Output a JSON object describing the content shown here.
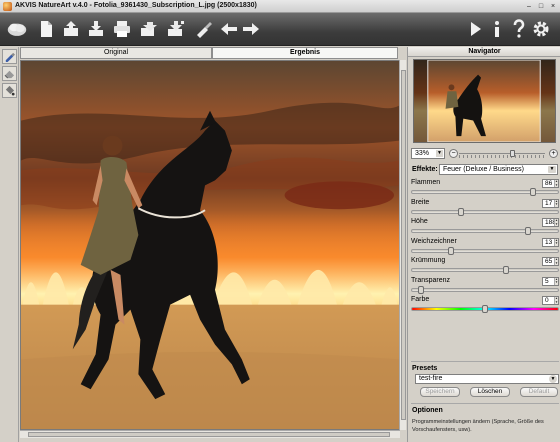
{
  "window": {
    "title": "AKVIS NatureArt v.4.0 - Fotolia_9361430_Subscription_L.jpg (2500x1830)",
    "minimize": "–",
    "maximize": "□",
    "close": "×"
  },
  "toolbar": {
    "left_icons": [
      "app-logo-icon",
      "new-document-icon",
      "open-file-icon",
      "save-file-icon",
      "print-icon",
      "export-icon",
      "import-icon",
      "brush-icon",
      "undo-arrow-icon",
      "redo-arrow-icon"
    ],
    "right_icons": [
      "run-play-icon",
      "info-icon",
      "help-icon",
      "settings-gear-icon"
    ]
  },
  "tabs": {
    "original": "Original",
    "result": "Ergebnis"
  },
  "navigator": {
    "title": "Navigator",
    "zoom": "33%",
    "zoom_level": 0.62,
    "zoom_minus": "−",
    "zoom_plus": "+"
  },
  "effects": {
    "label": "Effekte:",
    "value": "Feuer  (Deluxe / Business)"
  },
  "params": [
    {
      "label": "Flammen",
      "value": "86",
      "level": 0.84
    },
    {
      "label": "Breite",
      "value": "17",
      "level": 0.33
    },
    {
      "label": "Höhe",
      "value": "188",
      "level": 0.8
    },
    {
      "label": "Weichzeichner",
      "value": "13",
      "level": 0.26
    },
    {
      "label": "Krümmung",
      "value": "65",
      "level": 0.65
    },
    {
      "label": "Transparenz",
      "value": "5",
      "level": 0.05
    },
    {
      "label": "Farbe",
      "value": "0",
      "level": 0.5
    }
  ],
  "presets": {
    "title": "Presets",
    "value": "test-fire",
    "save": "Speichern",
    "delete": "Löschen",
    "default": "Default"
  },
  "options": {
    "title": "Optionen",
    "text": "Programmeinstellungen ändern (Sprache, Größe des Vorschaufensters, usw)."
  }
}
